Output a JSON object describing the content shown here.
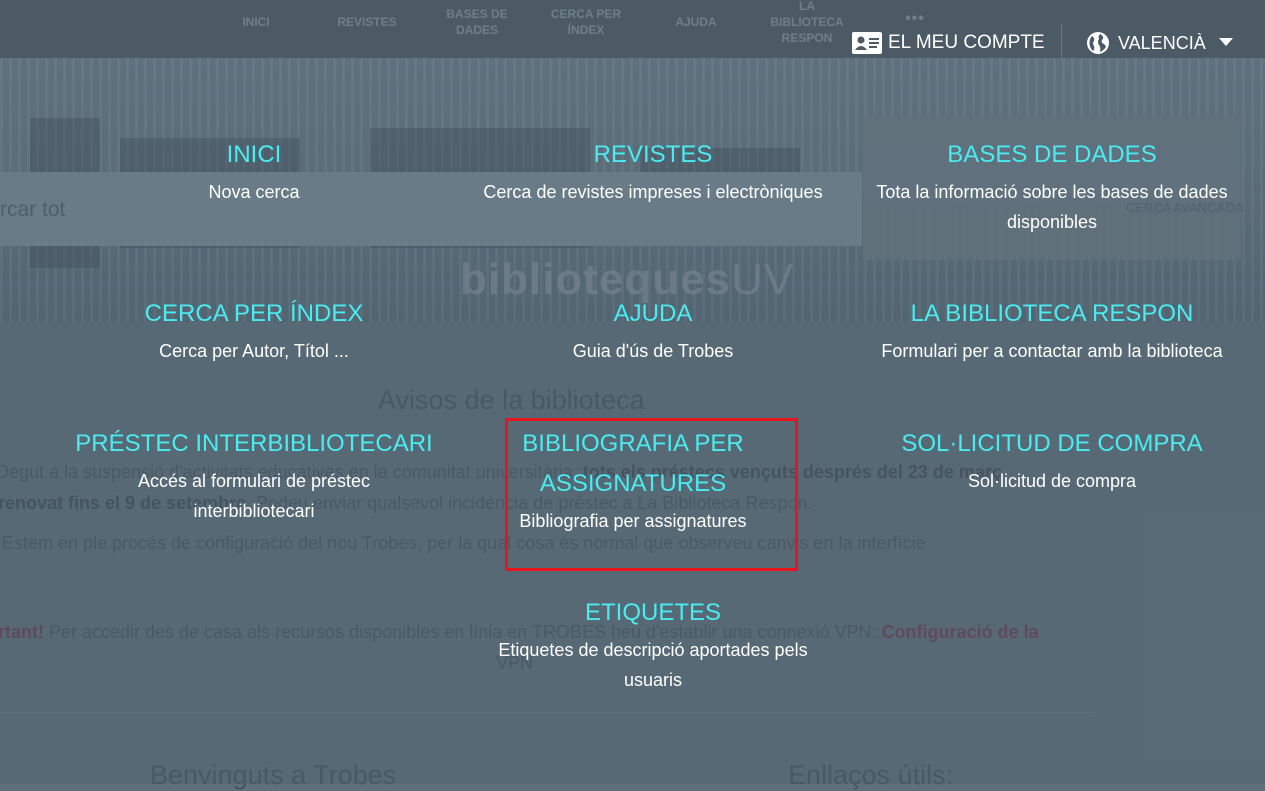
{
  "topbar": {
    "nav": [
      "INICI",
      "REVISTES",
      "BASES DE DADES",
      "CERCA PER ÍNDEX",
      "AJUDA",
      "LA BIBLIOTECA RESPON"
    ],
    "more": "•••",
    "account_label": "EL MEU COMPTE",
    "account_icon": "id-card-icon",
    "language_label": "VALENCIÀ",
    "language_icon": "globe-icon"
  },
  "background": {
    "search_placeholder": "rcar tot",
    "advanced_search": "CERCA AVANÇADA",
    "logo_text": "biblioteques",
    "logo_suffix": "UV",
    "notices_title": "Avisos de la biblioteca",
    "notice_1a": "Degut a la suspensió d'activitats educatives en la comunitat universitària, ",
    "notice_1b": "tots els préstecs vençuts després del 23 de març",
    "notice_2a": "renovat fins el 9 de setembre",
    "notice_2b": ". Podeu enviar qualsevol incidència de préstec a La Biblioteca Respon.",
    "notice_3": "Estem en ple procés de configuració del nou Trobes, per la qual cosa és normal que observeu canvis en la interfície",
    "notice_4a": "rtant!",
    "notice_4b": " Per accedir des de casa als recursos disponibles en línia en TROBES heu d'establir una connexió VPN: ",
    "notice_4c": "Configuració de la",
    "notice_5": "VPN",
    "welcome": "Benvinguts a Trobes",
    "useful_links": "Enllaços útils:"
  },
  "menu": {
    "items": [
      {
        "title": "INICI",
        "desc": "Nova cerca"
      },
      {
        "title": "REVISTES",
        "desc": "Cerca de revistes impreses i electròniques"
      },
      {
        "title": "BASES DE DADES",
        "desc": "Tota la informació sobre les bases de dades disponibles"
      },
      {
        "title": "CERCA PER ÍNDEX",
        "desc": "Cerca per Autor, Títol ..."
      },
      {
        "title": "AJUDA",
        "desc": "Guia d'ús de Trobes"
      },
      {
        "title": "LA BIBLIOTECA RESPON",
        "desc": "Formulari per a contactar amb la biblioteca"
      },
      {
        "title": "PRÉSTEC INTERBIBLIOTECARI",
        "desc": "Accés al formulari de préstec interbibliotecari"
      },
      {
        "title": "BIBLIOGRAFIA PER ASSIGNATURES",
        "desc": "Bibliografia per assignatures"
      },
      {
        "title": "SOL·LICITUD DE COMPRA",
        "desc": "Sol·licitud de compra"
      },
      {
        "title": "ETIQUETES",
        "desc": "Etiquetes de descripció aportades pels usuaris"
      }
    ]
  },
  "colors": {
    "menu_title": "#49ecf1",
    "menu_desc": "#ffffff",
    "topbar": "#4c5a66",
    "highlight": "#e8141c"
  }
}
